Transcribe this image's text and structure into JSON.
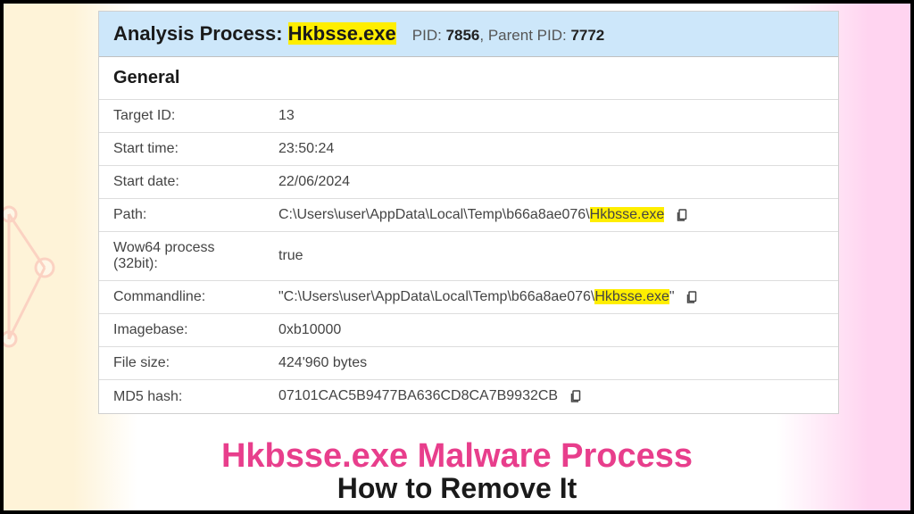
{
  "header": {
    "title_prefix": "Analysis Process: ",
    "process_name": "Hkbsse.exe",
    "pid_label": "PID: ",
    "pid_value": "7856",
    "parent_pid_sep": ", Parent PID: ",
    "parent_pid_value": "7772"
  },
  "section": {
    "general_title": "General"
  },
  "rows": {
    "target_id": {
      "label": "Target ID:",
      "value": "13"
    },
    "start_time": {
      "label": "Start time:",
      "value": "23:50:24"
    },
    "start_date": {
      "label": "Start date:",
      "value": "22/06/2024"
    },
    "path": {
      "label": "Path:",
      "prefix": "C:\\Users\\user\\AppData\\Local\\Temp\\b66a8ae076\\",
      "highlight": "Hkbsse.exe"
    },
    "wow64": {
      "label": "Wow64 process (32bit):",
      "value": "true"
    },
    "commandline": {
      "label": "Commandline:",
      "prefix": "\"C:\\Users\\user\\AppData\\Local\\Temp\\b66a8ae076\\",
      "highlight": "Hkbsse.exe",
      "suffix": "\""
    },
    "imagebase": {
      "label": "Imagebase:",
      "value": "0xb10000"
    },
    "filesize": {
      "label": "File size:",
      "value": "424'960 bytes"
    },
    "md5": {
      "label": "MD5 hash:",
      "value": "07101CAC5B9477BA636CD8CA7B9932CB"
    }
  },
  "footer": {
    "line1": "Hkbsse.exe Malware Process",
    "line2": "How to Remove It"
  }
}
